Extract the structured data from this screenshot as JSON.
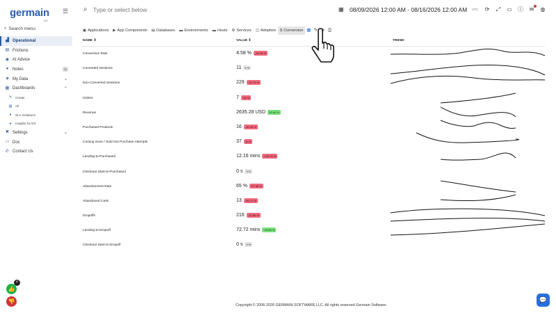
{
  "brand": {
    "name": "germain",
    "sub": "UX"
  },
  "sidebar": {
    "search_label": "Search menu",
    "items": [
      {
        "label": "Operational",
        "icon": "chart-icon",
        "active": true
      },
      {
        "label": "Frictions",
        "icon": "friction-icon"
      },
      {
        "label": "AI Advice",
        "icon": "ai-icon"
      },
      {
        "label": "Notes",
        "icon": "notes-icon",
        "badge": "AI"
      },
      {
        "label": "My Data",
        "icon": "data-icon",
        "chevron": "down"
      },
      {
        "label": "Dashboards",
        "icon": "dashboard-icon",
        "chevron": "up"
      }
    ],
    "sub_items": [
      {
        "label": "Create",
        "icon": "create-icon"
      },
      {
        "label": "All",
        "icon": "grid-icon"
      },
      {
        "label": "SLA Violations",
        "icon": "sla-icon"
      },
      {
        "label": "Insights for DX",
        "icon": "insights-icon"
      }
    ],
    "bottom_items": [
      {
        "label": "Settings",
        "icon": "settings-icon",
        "chevron": "down"
      },
      {
        "label": "Doc",
        "icon": "doc-icon"
      },
      {
        "label": "Contact Us",
        "icon": "contact-icon"
      }
    ]
  },
  "topbar": {
    "search_placeholder": "Type or select below",
    "date_range": "08/09/2026 12:00 AM - 08/16/2026 12:00 AM",
    "timezone": "UTC"
  },
  "tabs": [
    {
      "label": "Applications",
      "icon": "applications-icon"
    },
    {
      "label": "App Components",
      "icon": "components-icon"
    },
    {
      "label": "Databases",
      "icon": "database-icon"
    },
    {
      "label": "Environments",
      "icon": "environments-icon"
    },
    {
      "label": "Hosts",
      "icon": "hosts-icon"
    },
    {
      "label": "Services",
      "icon": "services-icon"
    },
    {
      "label": "Adoption",
      "icon": "adoption-icon"
    },
    {
      "label": "Conversion",
      "icon": "dollar-icon",
      "active": true
    }
  ],
  "table": {
    "columns": {
      "name": "NAME",
      "value": "VALUE",
      "trend": "TREND"
    },
    "rows": [
      {
        "name": "Conversion Rate",
        "value": "4.58 %",
        "change": "-18.33 %",
        "dir": "neg"
      },
      {
        "name": "Converted Sessions",
        "value": "11",
        "change": "0 %",
        "dir": "zero"
      },
      {
        "name": "Non-Converted Sessions",
        "value": "229",
        "change": "-13.75 %",
        "dir": "neg"
      },
      {
        "name": "Orders",
        "value": "7",
        "change": "-30 %",
        "dir": "neg"
      },
      {
        "name": "Revenue",
        "value": "2635.28 USD",
        "change": "20.84 %",
        "dir": "pos"
      },
      {
        "name": "Purchased Products",
        "value": "16",
        "change": "-30.43 %",
        "dir": "neg"
      },
      {
        "name": "Coming Soon / Sold Out Purchase Attempts",
        "value": "37",
        "change": "-8 %",
        "dir": "neg"
      },
      {
        "name": "Landing-to-Purchased",
        "value": "12.16 mins",
        "change": "-126.31 %",
        "dir": "neg"
      },
      {
        "name": "Checkout Start-to-Purchased",
        "value": "0 s",
        "change": "0 %",
        "dir": "zero"
      },
      {
        "name": "Abandonment Rate",
        "value": "65 %",
        "change": "-57.68 %",
        "dir": "neg"
      },
      {
        "name": "Abandoned Carts",
        "value": "13",
        "change": "-55.71 %",
        "dir": "neg"
      },
      {
        "name": "Dropoffs",
        "value": "216",
        "change": "-24.86 %",
        "dir": "neg"
      },
      {
        "name": "Landing-to-Dropoff",
        "value": "72.72 mins",
        "change": "-15.56 %",
        "dir": "pos"
      },
      {
        "name": "Checkout Start-to-Dropoff",
        "value": "0 s",
        "change": "0 %",
        "dir": "zero"
      }
    ]
  },
  "footer": "Copyright © 2006-2026 GERMAIN SOFTWARE LLC. All rights reserved Germain Software.",
  "colors": {
    "accent": "#2a5db0",
    "negative": "#f06a7e",
    "positive": "#7ae07d",
    "chat": "#2a6fdb"
  }
}
